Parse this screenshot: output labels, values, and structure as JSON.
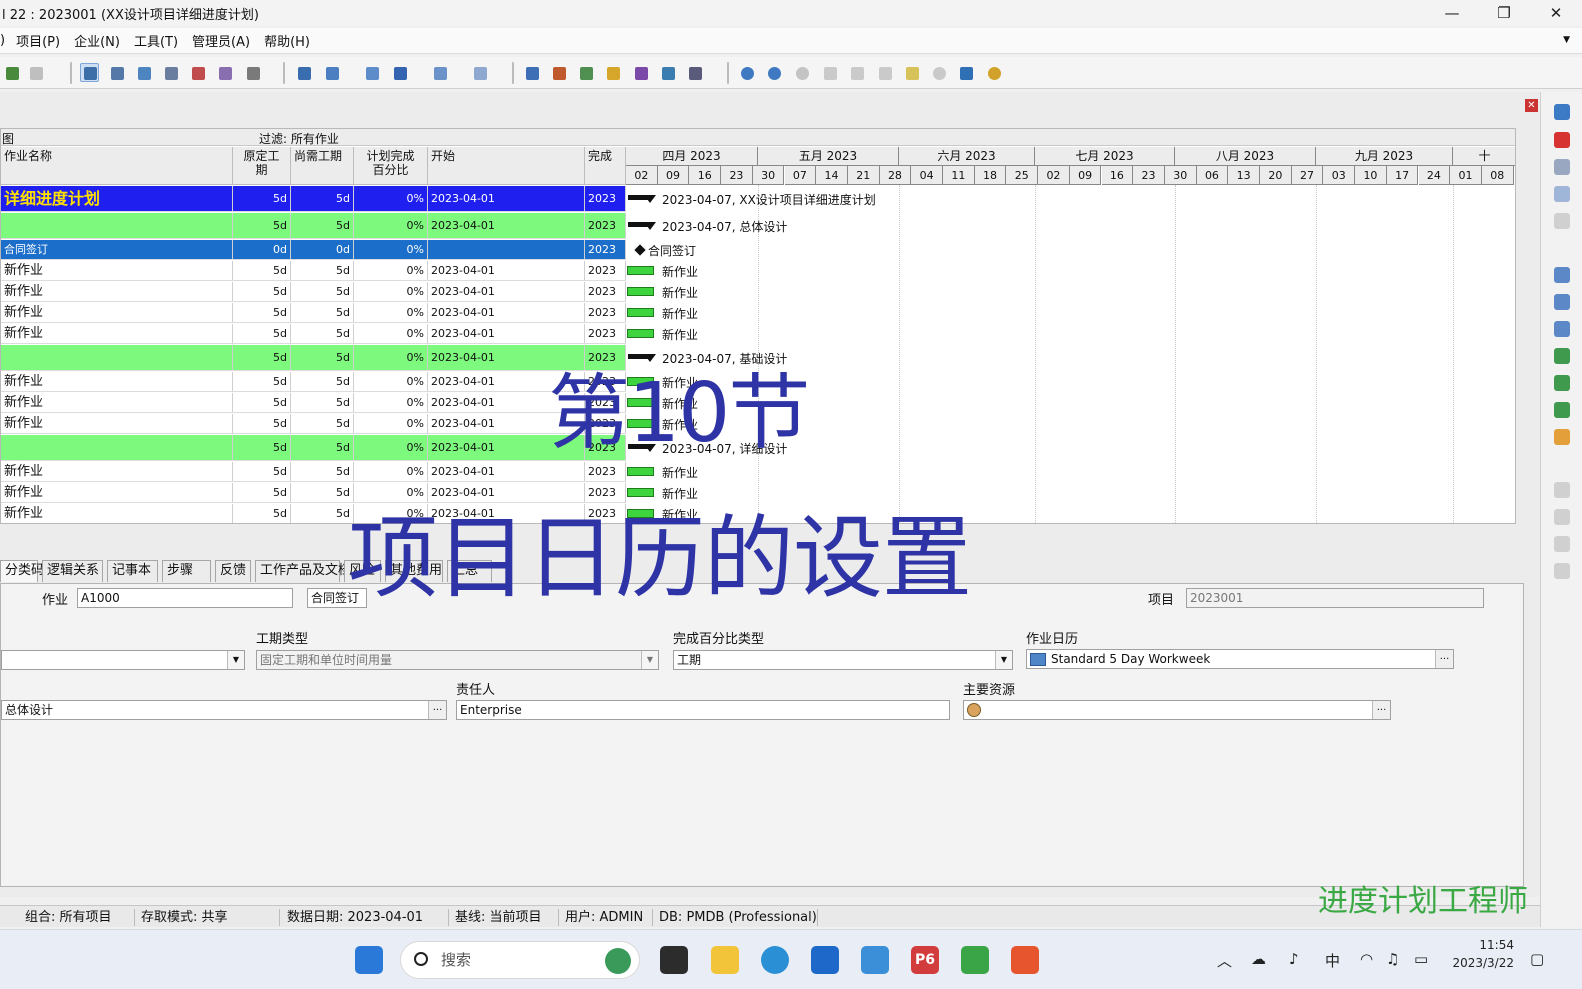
{
  "window": {
    "title": "l 22 : 2023001 (XX设计项目详细进度计划)",
    "minimize": "—",
    "restore": "❐",
    "close": "✕"
  },
  "menu": [
    "项目(P)",
    "企业(N)",
    "工具(T)",
    "管理员(A)",
    "帮助(H)"
  ],
  "menu_left_fragment": ")",
  "filter": {
    "left": "图",
    "label": "过滤: 所有作业"
  },
  "columns": {
    "name": "作业名称",
    "orig_dur": "原定工期",
    "rem_dur": "尚需工期",
    "pct": "计划完成百分比",
    "start": "开始",
    "finish": "完成"
  },
  "columns_split": {
    "orig_dur_1": "原定工",
    "orig_dur_2": "期",
    "pct_1": "计划完成",
    "pct_2": "百分比"
  },
  "rows": [
    {
      "type": "proj",
      "name": "详细进度计划",
      "od": "5d",
      "rd": "5d",
      "pct": "0%",
      "start": "2023-04-01",
      "fin": "2023"
    },
    {
      "type": "wbs",
      "name": "",
      "od": "5d",
      "rd": "5d",
      "pct": "0%",
      "start": "2023-04-01",
      "fin": "2023"
    },
    {
      "type": "sel",
      "name": "合同签订",
      "od": "0d",
      "rd": "0d",
      "pct": "0%",
      "start": "",
      "fin": "2023"
    },
    {
      "type": "norm",
      "name": "新作业",
      "od": "5d",
      "rd": "5d",
      "pct": "0%",
      "start": "2023-04-01",
      "fin": "2023"
    },
    {
      "type": "norm",
      "name": "新作业",
      "od": "5d",
      "rd": "5d",
      "pct": "0%",
      "start": "2023-04-01",
      "fin": "2023"
    },
    {
      "type": "norm",
      "name": "新作业",
      "od": "5d",
      "rd": "5d",
      "pct": "0%",
      "start": "2023-04-01",
      "fin": "2023"
    },
    {
      "type": "norm",
      "name": "新作业",
      "od": "5d",
      "rd": "5d",
      "pct": "0%",
      "start": "2023-04-01",
      "fin": "2023"
    },
    {
      "type": "wbs",
      "name": "",
      "od": "5d",
      "rd": "5d",
      "pct": "0%",
      "start": "2023-04-01",
      "fin": "2023"
    },
    {
      "type": "norm",
      "name": "新作业",
      "od": "5d",
      "rd": "5d",
      "pct": "0%",
      "start": "2023-04-01",
      "fin": "2023"
    },
    {
      "type": "norm",
      "name": "新作业",
      "od": "5d",
      "rd": "5d",
      "pct": "0%",
      "start": "2023-04-01",
      "fin": "2023"
    },
    {
      "type": "norm",
      "name": "新作业",
      "od": "5d",
      "rd": "5d",
      "pct": "0%",
      "start": "2023-04-01",
      "fin": "2023"
    },
    {
      "type": "wbs",
      "name": "",
      "od": "5d",
      "rd": "5d",
      "pct": "0%",
      "start": "2023-04-01",
      "fin": "2023"
    },
    {
      "type": "norm",
      "name": "新作业",
      "od": "5d",
      "rd": "5d",
      "pct": "0%",
      "start": "2023-04-01",
      "fin": "2023"
    },
    {
      "type": "norm",
      "name": "新作业",
      "od": "5d",
      "rd": "5d",
      "pct": "0%",
      "start": "2023-04-01",
      "fin": "2023"
    },
    {
      "type": "norm",
      "name": "新作业",
      "od": "5d",
      "rd": "5d",
      "pct": "0%",
      "start": "2023-04-01",
      "fin": "2023"
    }
  ],
  "gantt": {
    "months": [
      "四月 2023",
      "五月 2023",
      "六月 2023",
      "七月 2023",
      "八月 2023",
      "九月 2023",
      "十"
    ],
    "weeks": [
      "02",
      "09",
      "16",
      "23",
      "30",
      "07",
      "14",
      "21",
      "28",
      "04",
      "11",
      "18",
      "25",
      "02",
      "09",
      "16",
      "23",
      "30",
      "06",
      "13",
      "20",
      "27",
      "03",
      "10",
      "17",
      "24",
      "01",
      "08"
    ],
    "labels": [
      "2023-04-07, XX设计项目详细进度计划",
      "2023-04-07, 总体设计",
      "合同签订",
      "新作业",
      "新作业",
      "新作业",
      "新作业",
      "2023-04-07, 基础设计",
      "新作业",
      "新作业",
      "新作业",
      "2023-04-07, 详细设计",
      "新作业",
      "新作业",
      "新作业"
    ]
  },
  "tabs": [
    "分类码",
    "逻辑关系",
    "记事本",
    "步骤",
    "反馈",
    "工作产品及文档",
    "风险",
    "其他费用",
    "汇总"
  ],
  "form": {
    "act_label": "作业",
    "act_id": "A1000",
    "act_name": "合同签订",
    "proj_label": "项目",
    "proj_id": "2023001",
    "dur_type_label": "工期类型",
    "dur_type": "固定工期和单位时间用量",
    "pct_type_label": "完成百分比类型",
    "pct_type": "工期",
    "cal_label": "作业日历",
    "cal": "Standard 5 Day Workweek",
    "wbs_val": "总体设计",
    "owner_label": "责任人",
    "owner": "Enterprise",
    "res_label": "主要资源",
    "res": "",
    "ellipsis": "..."
  },
  "status": [
    "组合: 所有项目",
    "存取模式: 共享",
    "数据日期: 2023-04-01",
    "基线: 当前项目",
    "用户: ADMIN",
    "DB: PMDB (Professional)"
  ],
  "overlay": {
    "line1": "第10节",
    "line2": "项目日历的设置"
  },
  "watermark": "进度计划工程师",
  "taskbar": {
    "search": "搜索",
    "clock_time": "11:54",
    "clock_date": "2023/3/22",
    "ime": "中"
  },
  "colors": {
    "project_row": "#1f1ff0",
    "wbs_row": "#7dfa7d",
    "selected_row": "#1b6ec9",
    "bar": "#3ed43e",
    "overlay_text": "#2e33a6",
    "watermark": "#3aa843"
  }
}
